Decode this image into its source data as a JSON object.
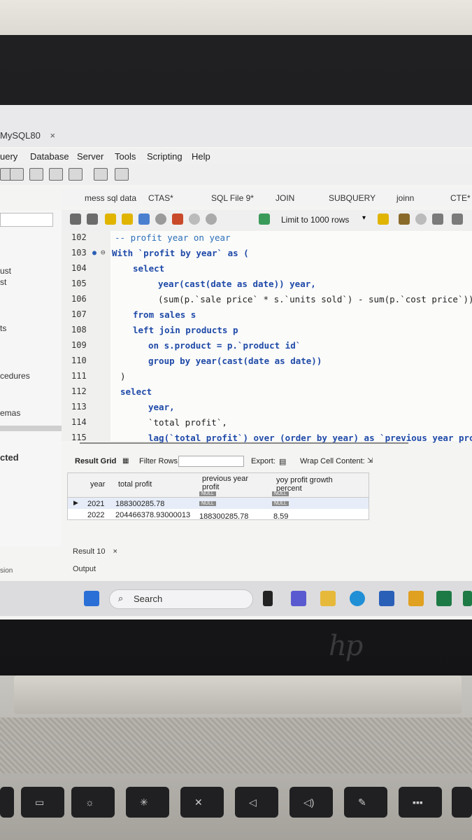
{
  "window": {
    "tab_title": "MySQL80",
    "close": "×"
  },
  "menu": [
    "uery",
    "Database",
    "Server",
    "Tools",
    "Scripting",
    "Help"
  ],
  "query_tabs": [
    "mess sql data",
    "CTAS*",
    "SQL File 9*",
    "JOIN",
    "SUBQUERY",
    "joinn",
    "CTE*"
  ],
  "left_panel": {
    "labels": [
      "ust",
      "st",
      "ts",
      "cedures",
      "emas",
      "cted",
      "sion"
    ]
  },
  "sql_toolbar": {
    "limit": "Limit to 1000 rows"
  },
  "editor": {
    "line_numbers": [
      "102",
      "103",
      "104",
      "105",
      "106",
      "107",
      "108",
      "109",
      "110",
      "111",
      "112",
      "113",
      "114",
      "115"
    ],
    "lines": [
      "-- profit year on year",
      "With `profit by year` as (",
      "select",
      "year(cast(date as date)) year,",
      "(sum(p.`sale price` * s.`units sold`) - sum(p.`cost price`)) as",
      "from sales s",
      "left join products p",
      "on s.product = p.`product id`",
      "group by year(cast(date as date))",
      ")",
      "select",
      "year,",
      "`total profit`,",
      "lag(`total profit`) over (order by year) as `previous year profit`,"
    ]
  },
  "results": {
    "result_grid": "Result Grid",
    "filter_rows": "Filter Rows:",
    "export": "Export:",
    "wrap": "Wrap Cell Content:",
    "columns": [
      "year",
      "total profit",
      "previous year profit",
      "yoy profit growth percent"
    ],
    "rows": [
      [
        "2021",
        "188300285.78",
        "NULL",
        "NULL"
      ],
      [
        "2022",
        "204466378.93000013",
        "188300285.78",
        "8.59"
      ]
    ],
    "header_nulls": [
      "NULL",
      "NULL"
    ]
  },
  "bottom": {
    "result_tab": "Result 10",
    "close": "×",
    "output": "Output"
  },
  "taskbar": {
    "search": "Search"
  },
  "brand": "hp"
}
